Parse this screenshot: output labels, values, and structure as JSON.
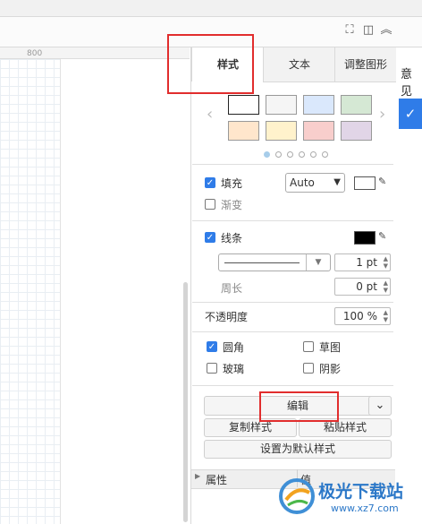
{
  "toolbar": {
    "fullscreen_icon": "fullscreen-icon",
    "panel_icon": "panel-toggle-icon",
    "collapse_icon": "chevron-up-icon"
  },
  "ruler": {
    "mark": "800"
  },
  "behind": {
    "partial_text": "意见"
  },
  "tabs": [
    {
      "label": "样式",
      "active": true
    },
    {
      "label": "文本",
      "active": false
    },
    {
      "label": "调整图形",
      "active": false
    }
  ],
  "palette": {
    "row1": [
      "#ffffff",
      "#f5f5f5",
      "#dae8fc",
      "#d5e8d4"
    ],
    "row2": [
      "#ffe6cc",
      "#fff2cc",
      "#f8cecc",
      "#e1d5e7"
    ],
    "page_dots": 6,
    "current_page": 1
  },
  "fill": {
    "label": "填充",
    "checked": true,
    "mode": "Auto",
    "color": "#ffffff"
  },
  "gradient": {
    "label": "渐变",
    "checked": false
  },
  "line": {
    "label": "线条",
    "checked": true,
    "color": "#000000",
    "width": "1 pt"
  },
  "perimeter": {
    "label": "周长",
    "value": "0 pt"
  },
  "opacity": {
    "label": "不透明度",
    "value": "100 %"
  },
  "options": {
    "rounded": {
      "label": "圆角",
      "checked": true
    },
    "sketch": {
      "label": "草图",
      "checked": false
    },
    "glass": {
      "label": "玻璃",
      "checked": false
    },
    "shadow": {
      "label": "阴影",
      "checked": false
    }
  },
  "buttons": {
    "edit": "编辑",
    "copy_style": "复制样式",
    "paste_style": "粘贴样式",
    "set_default": "设置为默认样式"
  },
  "properties": {
    "col_name": "属性",
    "col_value": "值"
  },
  "watermark": {
    "brand": "极光下载站",
    "url": "www.xz7.com"
  }
}
